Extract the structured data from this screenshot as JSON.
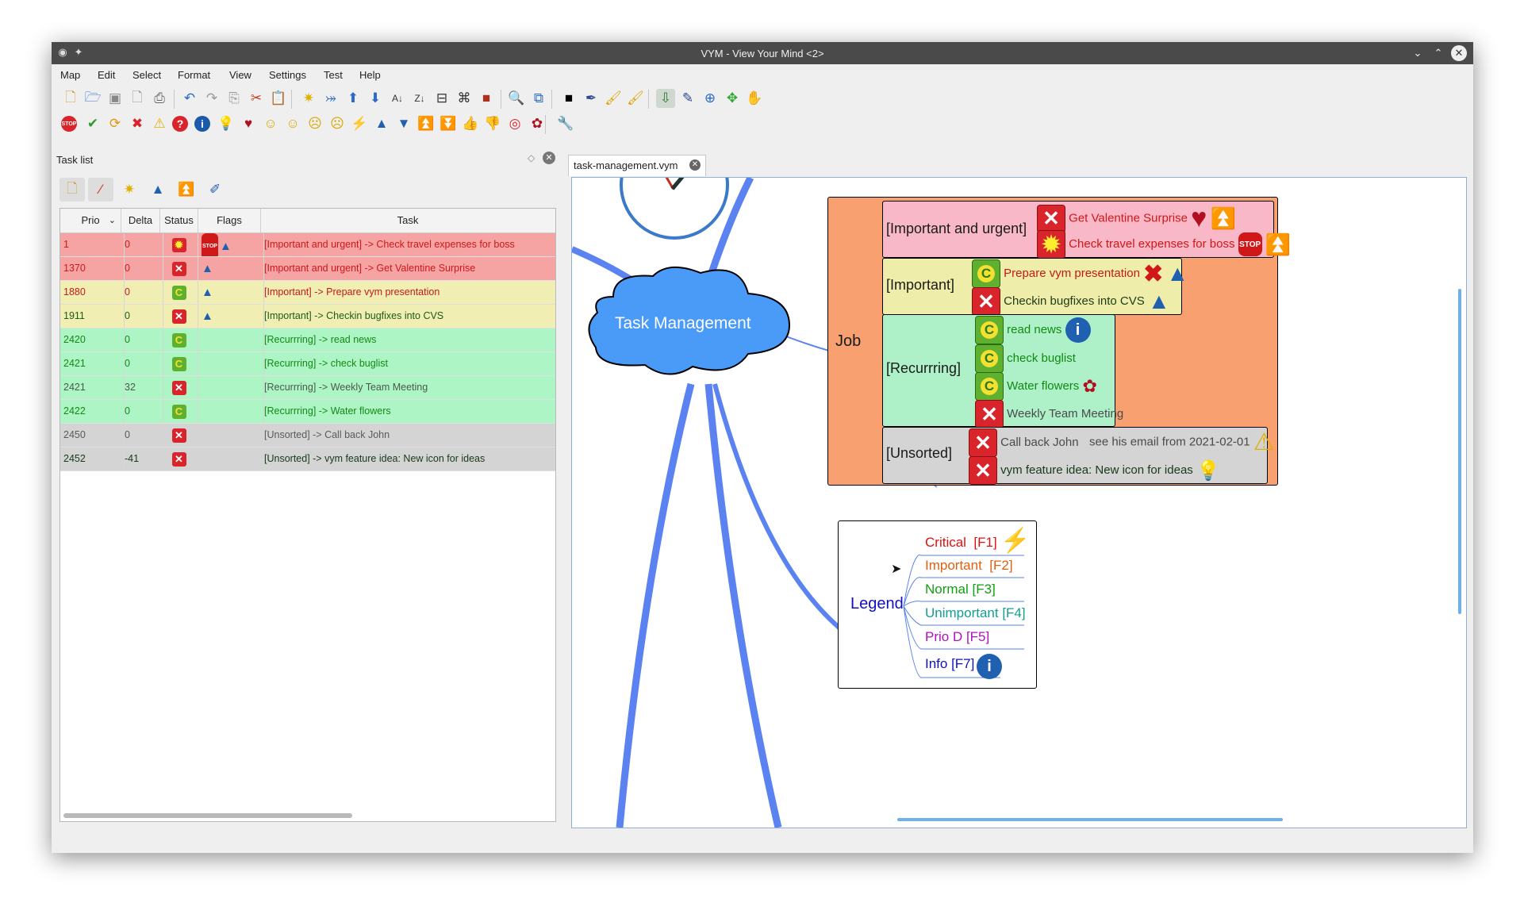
{
  "window": {
    "title": "VYM - View Your Mind <2>"
  },
  "menu": [
    "Map",
    "Edit",
    "Select",
    "Format",
    "View",
    "Settings",
    "Test",
    "Help"
  ],
  "toolbar1": [
    "new-file-icon",
    "open-folder-icon",
    "save-icon",
    "save-as-icon",
    "print-icon",
    "undo-icon",
    "redo-icon",
    "copy-icon",
    "cut-icon",
    "paste-icon",
    "add-branch-icon",
    "add-branch-before-icon",
    "move-up-icon",
    "move-down-icon",
    "sort-ascending-icon",
    "sort-descending-icon",
    "toggle-scroll-icon",
    "branch-icon",
    "color-icon",
    "find-icon",
    "filter-icon",
    "black-square-icon",
    "picker-icon",
    "format-paint-icon",
    "format-paint-subtree-icon",
    "link-icon",
    "pen-icon",
    "move-icon",
    "drag-icon",
    "hand-icon"
  ],
  "toolbar2": [
    {
      "name": "stop-icon",
      "glyph": "STOP",
      "color": "#d8242a"
    },
    {
      "name": "check-icon",
      "glyph": "✔",
      "color": "#2c9a2c"
    },
    {
      "name": "recurring-icon",
      "glyph": "⟳",
      "color": "#e09a10"
    },
    {
      "name": "cross-icon",
      "glyph": "✖",
      "color": "#d8242a"
    },
    {
      "name": "warning-icon",
      "glyph": "⚠",
      "color": "#e0b000"
    },
    {
      "name": "question-icon",
      "glyph": "?",
      "color": "#d8242a"
    },
    {
      "name": "info-icon",
      "glyph": "i",
      "color": "#1a5aa8"
    },
    {
      "name": "lightbulb-icon",
      "glyph": "💡",
      "color": "#e0c000"
    },
    {
      "name": "heart-icon",
      "glyph": "♥",
      "color": "#b01020"
    },
    {
      "name": "smiley-good-icon",
      "glyph": "☺",
      "color": "#d8a800"
    },
    {
      "name": "smiley-neutral-icon",
      "glyph": "☺",
      "color": "#d8a800"
    },
    {
      "name": "smiley-bad-icon",
      "glyph": "☹",
      "color": "#d8a800"
    },
    {
      "name": "smiley-omg-icon",
      "glyph": "☹",
      "color": "#d8a800"
    },
    {
      "name": "lightning-icon",
      "glyph": "⚡",
      "color": "#e0a000"
    },
    {
      "name": "arrow-up-icon",
      "glyph": "▲",
      "color": "#2060b0"
    },
    {
      "name": "arrow-down-icon",
      "glyph": "▼",
      "color": "#2060b0"
    },
    {
      "name": "double-arrow-up-icon",
      "glyph": "⏫",
      "color": "#2060b0"
    },
    {
      "name": "double-arrow-down-icon",
      "glyph": "⏬",
      "color": "#2060b0"
    },
    {
      "name": "thumb-up-icon",
      "glyph": "👍",
      "color": "#c07020"
    },
    {
      "name": "thumb-down-icon",
      "glyph": "👎",
      "color": "#c07020"
    },
    {
      "name": "lifebelt-icon",
      "glyph": "◎",
      "color": "#d8242a"
    },
    {
      "name": "rose-icon",
      "glyph": "✿",
      "color": "#b01020"
    },
    {
      "name": "tools-icon",
      "glyph": "🔧",
      "color": "#555555"
    }
  ],
  "tasklist": {
    "title": "Task list",
    "columns": {
      "prio": "Prio",
      "delta": "Delta",
      "status": "Status",
      "flags": "Flags",
      "task": "Task"
    },
    "rows": [
      {
        "prio": "1",
        "delta": "0",
        "status": "new",
        "flags": "STOP▲",
        "task": "[Important and urgent] -> Check travel expenses for boss",
        "bg": "#f5a3a3",
        "fg": "#d01818"
      },
      {
        "prio": "1370",
        "delta": "0",
        "status": "x",
        "flags": "▲",
        "task": "[Important and urgent] -> Get Valentine Surprise",
        "bg": "#f5a3a3",
        "fg": "#d01818"
      },
      {
        "prio": "1880",
        "delta": "0",
        "status": "c",
        "flags": "▲",
        "task": "[Important] -> Prepare vym presentation",
        "bg": "#f0eeb2",
        "fg": "#c81818"
      },
      {
        "prio": "1911",
        "delta": "0",
        "status": "x",
        "flags": "▲",
        "task": "[Important] -> Checkin bugfixes into CVS",
        "bg": "#f0eeb2",
        "fg": "#1e5a18"
      },
      {
        "prio": "2420",
        "delta": "0",
        "status": "c",
        "flags": "",
        "task": "[Recurrring] -> read news",
        "bg": "#aef5c6",
        "fg": "#128a14"
      },
      {
        "prio": "2421",
        "delta": "0",
        "status": "c",
        "flags": "",
        "task": "[Recurrring] -> check buglist",
        "bg": "#aef5c6",
        "fg": "#128a14"
      },
      {
        "prio": "2421",
        "delta": "32",
        "status": "x",
        "flags": "",
        "task": "[Recurrring] -> Weekly Team Meeting",
        "bg": "#aef5c6",
        "fg": "#4a5a4a"
      },
      {
        "prio": "2422",
        "delta": "0",
        "status": "c",
        "flags": "",
        "task": "[Recurrring] -> Water flowers",
        "bg": "#aef5c6",
        "fg": "#128a14"
      },
      {
        "prio": "2450",
        "delta": "0",
        "status": "x",
        "flags": "",
        "task": "[Unsorted] -> Call back John",
        "bg": "#d4d4d4",
        "fg": "#5a5a5a"
      },
      {
        "prio": "2452",
        "delta": "-41",
        "status": "x",
        "flags": "",
        "task": "[Unsorted] -> vym feature idea: New icon for ideas",
        "bg": "#d4d4d4",
        "fg": "#163a18"
      }
    ]
  },
  "tab": {
    "label": "task-management.vym"
  },
  "map": {
    "central": "Task Management",
    "job": "Job",
    "groups": {
      "urgent": "[Important and urgent]",
      "important": "[Important]",
      "recurring": "[Recurrring]",
      "unsorted": "[Unsorted]"
    },
    "tasks": {
      "valentine": "Get Valentine Surprise",
      "travel": "Check travel expenses for boss",
      "prepare": "Prepare vym presentation",
      "checkin": "Checkin bugfixes into CVS",
      "news": "read news",
      "buglist": "check buglist",
      "flowers": "Water flowers",
      "weekly": "Weekly Team Meeting",
      "callback": "Call back John",
      "email": "see his email from 2021-02-01",
      "idea": "vym feature idea: New icon for ideas"
    },
    "legend": {
      "title": "Legend",
      "items": [
        {
          "label": "Critical  [F1]",
          "color": "#e01010"
        },
        {
          "label": "Important  [F2]",
          "color": "#e06010"
        },
        {
          "label": "Normal [F3]",
          "color": "#10a010"
        },
        {
          "label": "Unimportant [F4]",
          "color": "#10a090"
        },
        {
          "label": "Prio D [F5]",
          "color": "#b010c0"
        },
        {
          "label": "Info [F7]",
          "color": "#1010c0"
        }
      ]
    },
    "colors": {
      "branch": "#5a82f0",
      "job_bg": "#f8a070",
      "urgent_bg": "#f8b8c8",
      "important_bg": "#eeeeaa",
      "recurring_bg": "#aef0c8",
      "unsorted_bg": "#d4d4d4"
    }
  }
}
